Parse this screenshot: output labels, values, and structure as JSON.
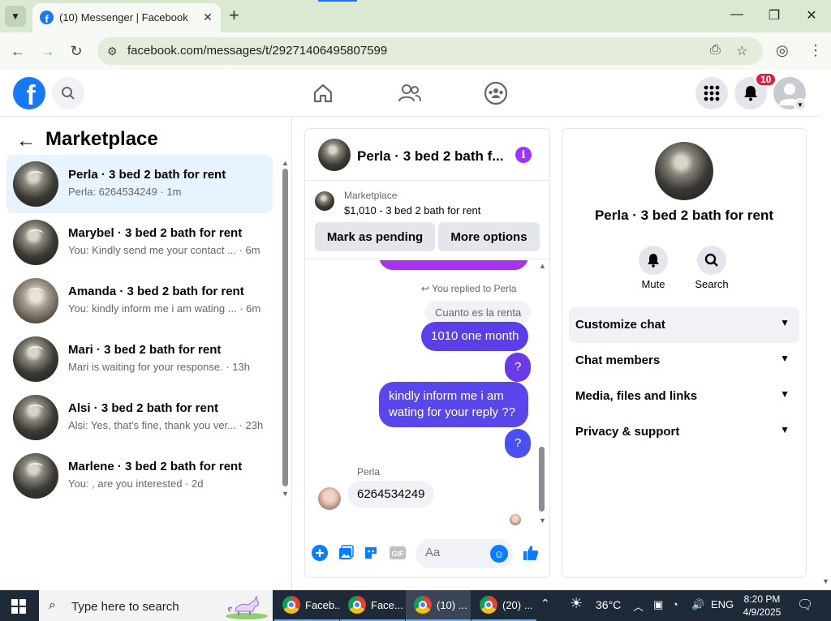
{
  "browser": {
    "tab_title": "(10) Messenger | Facebook",
    "url": "facebook.com/messages/t/29271406495807599",
    "tab_favicon": "f"
  },
  "facebook": {
    "logo_letter": "f",
    "notification_count": "10",
    "brand_color": "#1877f2"
  },
  "marketplace": {
    "title": "Marketplace",
    "conversations": [
      {
        "name": "Perla · 3 bed 2 bath for rent",
        "preview": "Perla: 6264534249 · 1m",
        "active": true
      },
      {
        "name": "Marybel · 3 bed 2 bath for rent",
        "preview": "You: Kindly send me your contact ... · 6m"
      },
      {
        "name": "Amanda · 3 bed 2 bath for rent",
        "preview": "You: kindly inform me i am wating ... · 6m"
      },
      {
        "name": "Mari · 3 bed 2 bath for rent",
        "preview": "Mari is waiting for your response. · 13h"
      },
      {
        "name": "Alsi · 3 bed 2 bath for rent",
        "preview": "Alsi: Yes, that's fine, thank you ver... · 23h"
      },
      {
        "name": "Marlene · 3 bed 2 bath for rent",
        "preview": "You: , are you interested · 2d"
      }
    ]
  },
  "chat": {
    "title": "Perla · 3 bed 2 bath f...",
    "listing_label": "Marketplace",
    "listing_price": "$1,010 - 3 bed 2 bath for rent",
    "mark_pending": "Mark as pending",
    "more_options": "More options",
    "replied_note": "You replied to Perla",
    "quoted": "Cuanto es la renta",
    "msg_1010": "1010 one month",
    "msg_q1": "?",
    "msg_inform_1": "kindly inform me i am",
    "msg_inform_2": "wating for your reply ??",
    "msg_q2": "?",
    "sender": "Perla",
    "incoming": "6264534249",
    "composer_placeholder": "Aa"
  },
  "info": {
    "name": "Perla · 3 bed 2 bath for rent",
    "mute": "Mute",
    "search": "Search",
    "sections": [
      "Customize chat",
      "Chat members",
      "Media, files and links",
      "Privacy & support"
    ]
  },
  "taskbar": {
    "search_placeholder": "Type here to search",
    "items": [
      "Faceb...",
      "Face...",
      "(10) ...",
      "(20) ..."
    ],
    "temperature": "36°C",
    "lang": "ENG",
    "time": "8:20 PM",
    "date": "4/9/2025"
  }
}
